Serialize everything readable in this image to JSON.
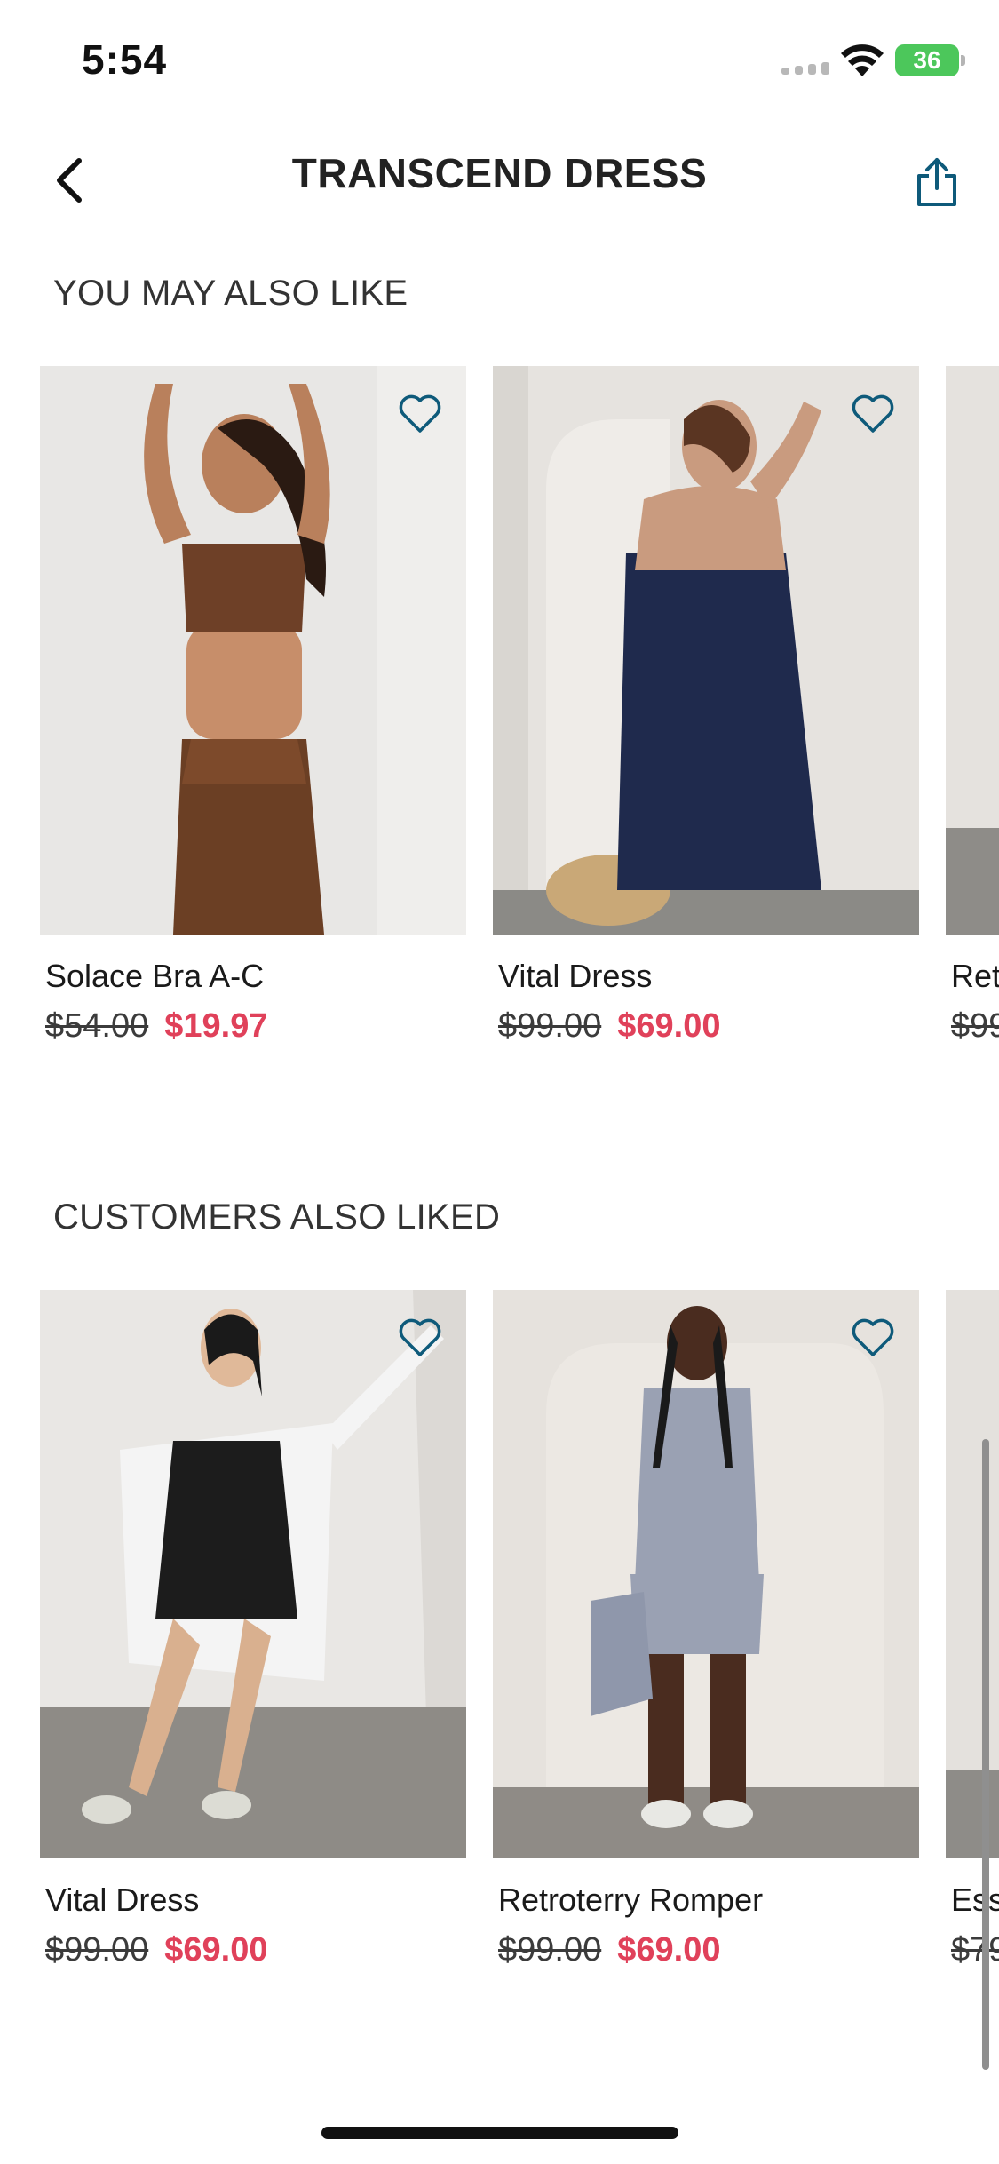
{
  "status_bar": {
    "time": "5:54",
    "battery": "36"
  },
  "header": {
    "title": "TRANSCEND DRESS"
  },
  "sections": [
    {
      "title": "YOU MAY ALSO LIKE",
      "products": [
        {
          "name": "Solace Bra A-C",
          "original_price": "$54.00",
          "sale_price": "$19.97"
        },
        {
          "name": "Vital Dress",
          "original_price": "$99.00",
          "sale_price": "$69.00"
        },
        {
          "name": "Ret",
          "original_price": "$99",
          "sale_price": ""
        }
      ]
    },
    {
      "title": "CUSTOMERS ALSO LIKED",
      "products": [
        {
          "name": "Vital Dress",
          "original_price": "$99.00",
          "sale_price": "$69.00"
        },
        {
          "name": "Retroterry Romper",
          "original_price": "$99.00",
          "sale_price": "$69.00"
        },
        {
          "name": "Ess",
          "original_price": "$79",
          "sale_price": ""
        }
      ]
    }
  ],
  "colors": {
    "accent": "#0e5a7a",
    "sale": "#e0415a",
    "battery": "#4cc75b"
  }
}
